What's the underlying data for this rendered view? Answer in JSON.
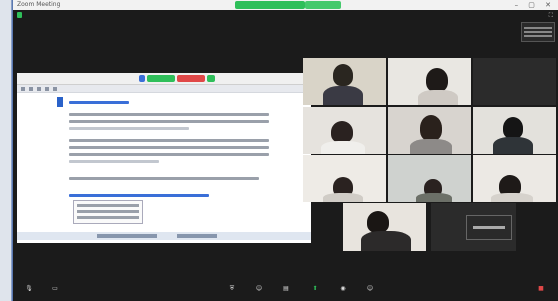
{
  "window": {
    "title": "Zoom Meeting",
    "controls": "– ▢ ✕"
  },
  "topbar": {
    "right_label": "⛶"
  },
  "tiles": [
    {
      "id": "t1",
      "label": ""
    },
    {
      "id": "t2",
      "label": ""
    },
    {
      "id": "t3",
      "label": ""
    },
    {
      "id": "t4",
      "label": ""
    },
    {
      "id": "t5",
      "label": ""
    },
    {
      "id": "t6",
      "label": ""
    },
    {
      "id": "t7",
      "label": ""
    },
    {
      "id": "t8",
      "label": ""
    },
    {
      "id": "t9",
      "label": ""
    },
    {
      "id": "t10",
      "label": ""
    },
    {
      "id": "t11",
      "label": ""
    }
  ],
  "controls": [
    {
      "name": "mute",
      "icon": "mic-icon",
      "glyph": "🎙",
      "label": ""
    },
    {
      "name": "video",
      "icon": "video-icon",
      "glyph": "▭",
      "label": ""
    },
    {
      "name": "security",
      "icon": "shield-icon",
      "glyph": "⛨",
      "label": ""
    },
    {
      "name": "participants",
      "icon": "people-icon",
      "glyph": "☺",
      "label": ""
    },
    {
      "name": "chat",
      "icon": "chat-icon",
      "glyph": "▤",
      "label": ""
    },
    {
      "name": "share",
      "icon": "share-icon",
      "glyph": "⬆",
      "label": ""
    },
    {
      "name": "record",
      "icon": "record-icon",
      "glyph": "◉",
      "label": ""
    },
    {
      "name": "reactions",
      "icon": "smile-icon",
      "glyph": "☺",
      "label": ""
    },
    {
      "name": "end",
      "icon": "end-icon",
      "glyph": "■",
      "label": ""
    }
  ],
  "colors": {
    "accent": "#2fbf5a",
    "end": "#e04848",
    "doc_blue": "#2a62c9"
  }
}
